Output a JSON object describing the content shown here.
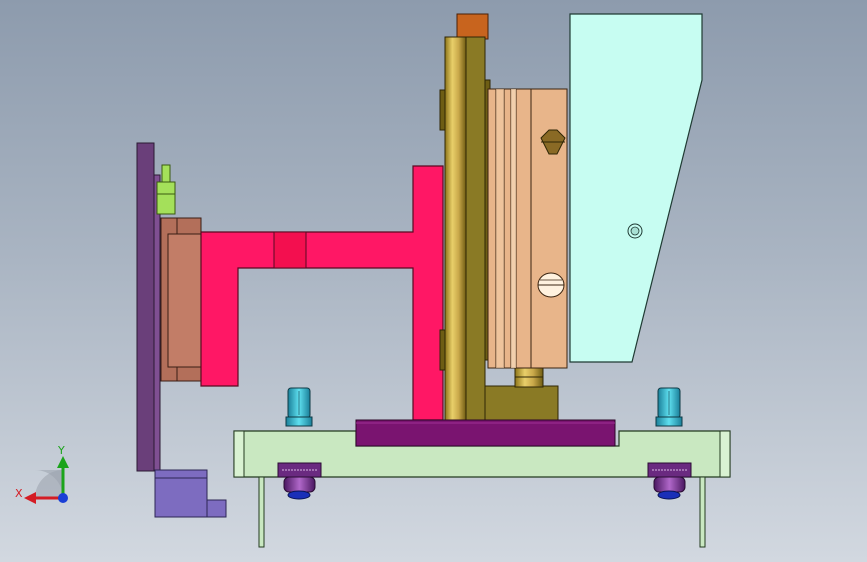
{
  "viewport": {
    "background_top": "#8d9bad",
    "background_bottom": "#d2d8e0"
  },
  "colors": {
    "base_plate": "#c9e8c1",
    "purple_spacer": "#7a1470",
    "pink_arm": "#ff1765",
    "cylinder_body": "#e8b58a",
    "cylinder_rod": "#c9a84a",
    "bronze_rail": "#8a7a25",
    "orange_cap": "#c8641e",
    "shield": "#c7fdf2",
    "suction_holder": "#c27d67",
    "left_rail": "#6a3f7a",
    "bottom_block": "#7d6cc0",
    "cap_screw": "#2bb6cf",
    "locating_pin": "#a4e05a",
    "foot": "#7b2a8e"
  },
  "triad": {
    "icon": "coordinate-triad-icon",
    "x_label": "X",
    "y_label": "Y",
    "x_color": "#d41c24",
    "y_color": "#1ba41b",
    "z_color": "#1a3fd6"
  }
}
